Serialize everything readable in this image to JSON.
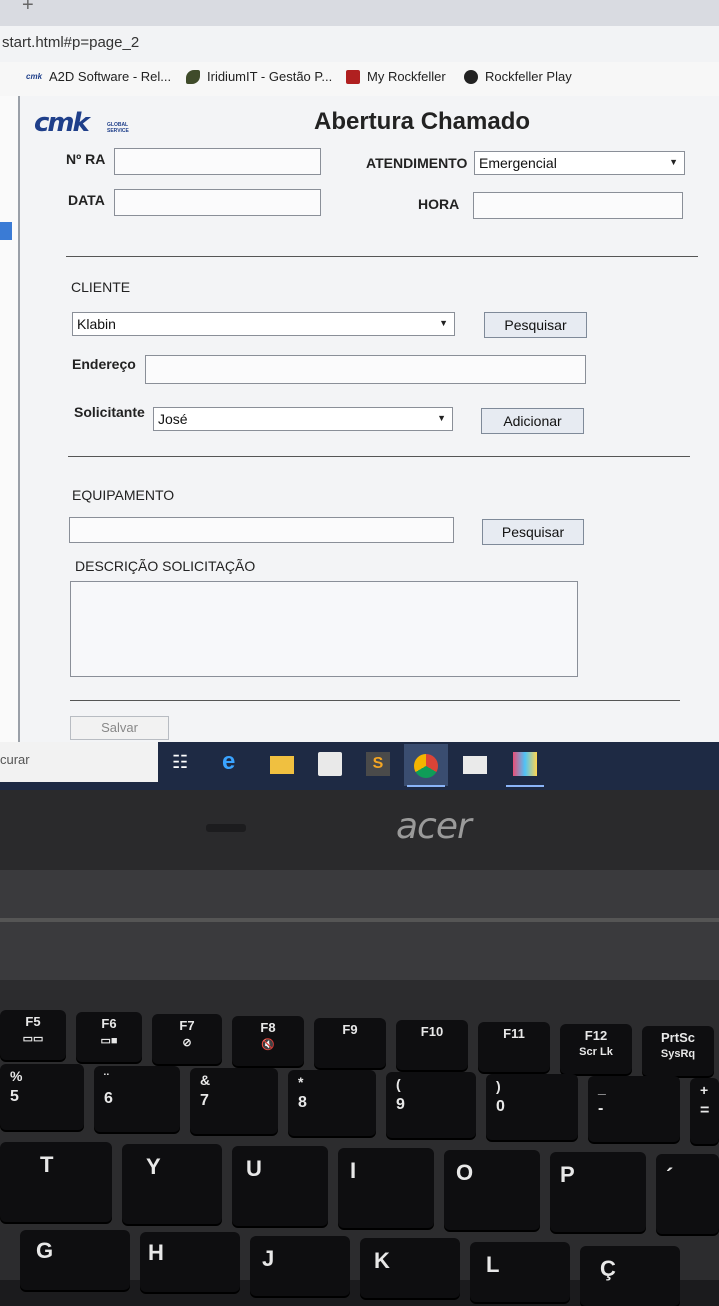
{
  "browser": {
    "url": "start.html#p=page_2",
    "bookmarks": [
      {
        "label": "A2D Software - Rel..."
      },
      {
        "label": "IridiumIT - Gestão P..."
      },
      {
        "label": "My Rockfeller"
      },
      {
        "label": "Rockfeller Play"
      }
    ]
  },
  "form": {
    "title": "Abertura Chamado",
    "nra_label": "Nº RA",
    "nra_value": "",
    "atendimento_label": "ATENDIMENTO",
    "atendimento_value": "Emergencial",
    "data_label": "DATA",
    "data_value": "",
    "hora_label": "HORA",
    "hora_value": "",
    "cliente_label": "CLIENTE",
    "cliente_value": "Klabin",
    "cliente_search": "Pesquisar",
    "endereco_label": "Endereço",
    "endereco_value": "",
    "solicitante_label": "Solicitante",
    "solicitante_value": "José",
    "solicitante_add": "Adicionar",
    "equipamento_label": "EQUIPAMENTO",
    "equipamento_value": "",
    "equipamento_search": "Pesquisar",
    "descricao_label": "DESCRIÇÃO SOLICITAÇÃO",
    "descricao_value": "",
    "save_label": "Salvar"
  },
  "taskbar": {
    "search_placeholder": "curar"
  },
  "laptop": {
    "brand": "acer"
  },
  "keyboard": {
    "fkeys": [
      {
        "top": "F5",
        "bottom": ""
      },
      {
        "top": "F6",
        "bottom": ""
      },
      {
        "top": "F7",
        "bottom": ""
      },
      {
        "top": "F8",
        "bottom": ""
      },
      {
        "top": "F9",
        "bottom": ""
      },
      {
        "top": "F10",
        "bottom": ""
      },
      {
        "top": "F11",
        "bottom": ""
      },
      {
        "top": "F12",
        "bottom": "Scr Lk"
      },
      {
        "top": "PrtSc",
        "bottom": "SysRq"
      }
    ],
    "numrow": [
      {
        "top": "%",
        "bottom": "5"
      },
      {
        "top": "¨",
        "bottom": "6"
      },
      {
        "top": "&",
        "bottom": "7"
      },
      {
        "top": "*",
        "bottom": "8"
      },
      {
        "top": "(",
        "bottom": "9"
      },
      {
        "top": ")",
        "bottom": "0"
      },
      {
        "top": "_",
        "bottom": "-"
      },
      {
        "top": "+",
        "bottom": "="
      }
    ],
    "row2": [
      "T",
      "Y",
      "U",
      "I",
      "O",
      "P",
      "´"
    ],
    "row3": [
      "G",
      "H",
      "J",
      "K",
      "L",
      "Ç"
    ]
  }
}
